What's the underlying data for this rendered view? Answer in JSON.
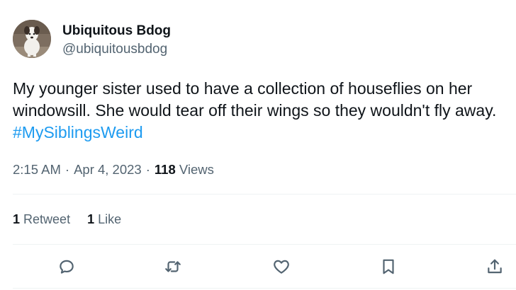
{
  "user": {
    "display_name": "Ubiquitous Bdog",
    "handle": "@ubiquitousbdog"
  },
  "tweet": {
    "line1": "My younger sister used to have a collection of houseflies on her",
    "line2": "windowsill. She would tear off their wings so they wouldn't fly away.",
    "hashtag": "#MySiblingsWeird"
  },
  "meta": {
    "time": "2:15 AM",
    "date": "Apr 4, 2023",
    "views_count": "118",
    "views_label": "Views"
  },
  "stats": {
    "retweets_count": "1",
    "retweets_label": "Retweet",
    "likes_count": "1",
    "likes_label": "Like"
  },
  "icons": {
    "reply": "reply-icon",
    "retweet": "retweet-icon",
    "like": "heart-icon",
    "bookmark": "bookmark-icon",
    "share": "share-icon"
  },
  "colors": {
    "text": "#0f1419",
    "secondary": "#536471",
    "link": "#1d9bf0",
    "divider": "#eff3f4"
  }
}
